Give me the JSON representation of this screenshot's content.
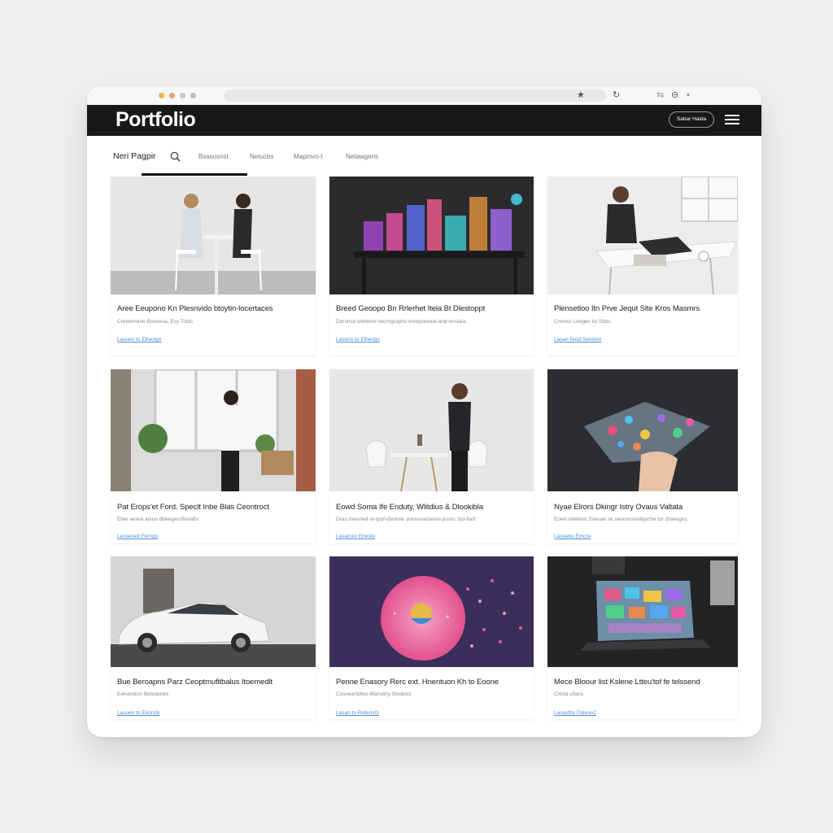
{
  "header": {
    "title": "Portfolio",
    "button_label": "Sabar Haida"
  },
  "nav": {
    "active_tab": "Neri Pagpir",
    "tabs": [
      "Bsasosnst",
      "Netucbs",
      "Mapmvo-t",
      "Netawgeris"
    ]
  },
  "cards": [
    {
      "title": "Aree Eeupono Kn Plesnvido btoytin-locertaces",
      "subtitle": "Crewsmane Boosesa. Esy Tolds",
      "link": "Lasuen to Elherign"
    },
    {
      "title": "Breed Geoopo Bn Rrlerhet Itela Bt Dlestoppt",
      "subtitle": "Dorsnsd shetene necrngraphc onreporeeat and enstala.",
      "link": "Laseno to Elherign"
    },
    {
      "title": "Plensetloo Itn Prve Jequt Slte Kros Masmrs",
      "subtitle": "Cnsnss Lireges Isi Sbbs",
      "link": "Lasan fivod Selstion"
    },
    {
      "title": "Pat Erops'et Ford. Speclt Inbe Blas Ceontroct",
      "subtitle": "Eber eeara atsun dbeegeo Bssafis",
      "link": "Lesseneit Ferngo"
    },
    {
      "title": "Eowd Soma Ife Enduty, Wlitdius & Dlookibla",
      "subtitle": "Drau meuned nt-rpof-dsotoal. porsosaotaces posts. bsl-faof",
      "link": "Lasacolo Eriesto"
    },
    {
      "title": "Nyae Elrors Dkingr Istry Ovaus Valtata",
      "subtitle": "Eorel oheteon Sseuan sk seonsosnsitysche tor draesgns.",
      "link": "Lassebo Emcre"
    },
    {
      "title": "Bue Beroapns Parz Ceoptmufitbalus Itoemedlt",
      "subtitle": "Eelseraton Besstenes",
      "link": "Lasuen to Eriorsbi"
    },
    {
      "title": "Penne Enasory Rerc ext. Hnentuon Kh to Eoone",
      "subtitle": "Cosneartpfoo-Marrotiry Stisbors",
      "link": "Lasan to Rotenst3"
    },
    {
      "title": "Mece Bloour list Kslene Ltteu'tof fe telssend",
      "subtitle": "Crtsta Ulans",
      "link": "Lasasthy Pateon2"
    }
  ],
  "colors": {
    "header_bg": "#18181a",
    "link": "#4a8fd9",
    "page_bg": "#efefef"
  },
  "icons": [
    "search-icon",
    "menu-icon",
    "star-icon",
    "reload-icon"
  ]
}
